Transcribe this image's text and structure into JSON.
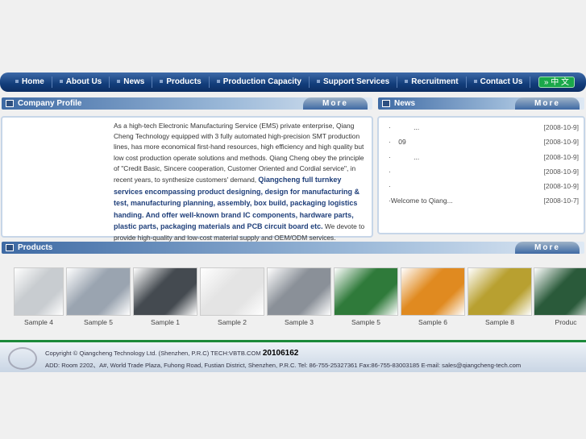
{
  "nav": {
    "items": [
      "Home",
      "About Us",
      "News",
      "Products",
      "Production Capacity",
      "Support Services",
      "Recruitment",
      "Contact Us"
    ],
    "lang": "» 中 文"
  },
  "profile": {
    "title": "Company Profile",
    "more": "More",
    "text_a": "As a high-tech Electronic Manufacturing Service (EMS) private enterprise, Qiang Cheng Technology equipped with 3 fully automated high-precision SMT production lines, has more economical first-hand resources, high efficiency and high quality but low cost production operate solutions and methods. Qiang Cheng obey the principle of \"Credit Basic, Sincere cooperation, Customer Oriented and Cordial service\", in recent years, to synthesize customers' demand,",
    "text_b": "Qiangcheng full turnkey services encompassing product designing, design for manufacturing & test, manufacturing planning, assembly, box build, packaging logistics handing. And offer well-known brand IC components, hardware parts, plastic parts, packaging materials and PCB circuit board etc.",
    "text_c": " We devote to provide high-quality and low-cost material supply and OEM/ODM services."
  },
  "news": {
    "title": "News",
    "more": "More",
    "items": [
      {
        "title": "·            ...",
        "date": "[2008-10-9]"
      },
      {
        "title": "·    09",
        "date": "[2008-10-9]"
      },
      {
        "title": "·            ...",
        "date": "[2008-10-9]"
      },
      {
        "title": "·",
        "date": "[2008-10-9]"
      },
      {
        "title": "·",
        "date": "[2008-10-9]"
      },
      {
        "title": "·Welcome to Qiang...",
        "date": "[2008-10-7]"
      }
    ]
  },
  "products": {
    "title": "Products",
    "more": "More",
    "items": [
      {
        "label": "Sample 4",
        "color": "#c8ccd0"
      },
      {
        "label": "Sample 5",
        "color": "#9aa4b0"
      },
      {
        "label": "Sample 1",
        "color": "#444a50"
      },
      {
        "label": "Sample 2",
        "color": "#e4e4e4"
      },
      {
        "label": "Sample 3",
        "color": "#8a9098"
      },
      {
        "label": "Sample 5",
        "color": "#2f7a3a"
      },
      {
        "label": "Sample 6",
        "color": "#e08a20"
      },
      {
        "label": "Sample 8",
        "color": "#b8a030"
      },
      {
        "label": "Produc",
        "color": "#2a5a3a"
      }
    ]
  },
  "footer": {
    "line1": "Copyright © Qiangcheng Technology Ltd. (Shenzhen, P.R.C)   TECH:VBTB.COM",
    "counter": "20106162",
    "line2": "ADD: Room 2202、A#, World Trade Plaza, Fuhong Road, Fustian District, Shenzhen, P.R.C.   Tel: 86-755-25327361   Fax:86-755-83003185   E-mail: sales@qiangcheng-tech.com"
  }
}
